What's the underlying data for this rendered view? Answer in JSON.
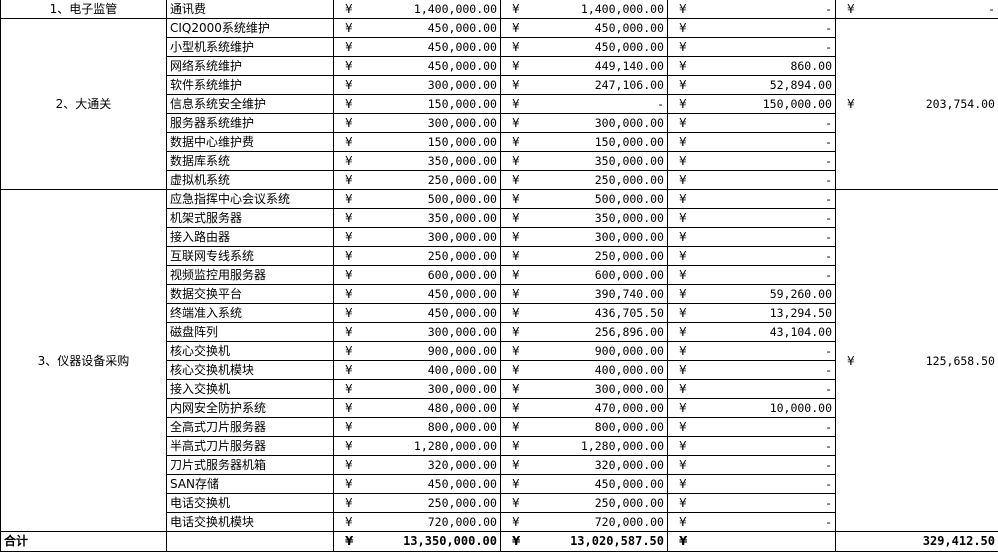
{
  "currency": "¥",
  "groups": [
    {
      "category": "1、电子监管",
      "subtotal": "-",
      "rows": [
        {
          "item": "通讯费",
          "budget": "1,400,000.00",
          "actual": "1,400,000.00",
          "diff": "-"
        }
      ]
    },
    {
      "category": "2、大通关",
      "subtotal": "203,754.00",
      "rows": [
        {
          "item": "CIQ2000系统维护",
          "budget": "450,000.00",
          "actual": "450,000.00",
          "diff": "-"
        },
        {
          "item": "小型机系统维护",
          "budget": "450,000.00",
          "actual": "450,000.00",
          "diff": "-"
        },
        {
          "item": "网络系统维护",
          "budget": "450,000.00",
          "actual": "449,140.00",
          "diff": "860.00"
        },
        {
          "item": "软件系统维护",
          "budget": "300,000.00",
          "actual": "247,106.00",
          "diff": "52,894.00"
        },
        {
          "item": "信息系统安全维护",
          "budget": "150,000.00",
          "actual": "-",
          "diff": "150,000.00"
        },
        {
          "item": "服务器系统维护",
          "budget": "300,000.00",
          "actual": "300,000.00",
          "diff": "-"
        },
        {
          "item": "数据中心维护费",
          "budget": "150,000.00",
          "actual": "150,000.00",
          "diff": "-"
        },
        {
          "item": "数据库系统",
          "budget": "350,000.00",
          "actual": "350,000.00",
          "diff": "-"
        },
        {
          "item": "虚拟机系统",
          "budget": "250,000.00",
          "actual": "250,000.00",
          "diff": "-"
        }
      ]
    },
    {
      "category": "3、仪器设备采购",
      "subtotal": "125,658.50",
      "rows": [
        {
          "item": "应急指挥中心会议系统",
          "budget": "500,000.00",
          "actual": "500,000.00",
          "diff": "-"
        },
        {
          "item": "机架式服务器",
          "budget": "350,000.00",
          "actual": "350,000.00",
          "diff": "-"
        },
        {
          "item": "接入路由器",
          "budget": "300,000.00",
          "actual": "300,000.00",
          "diff": "-"
        },
        {
          "item": "互联网专线系统",
          "budget": "250,000.00",
          "actual": "250,000.00",
          "diff": "-"
        },
        {
          "item": "视频监控用服务器",
          "budget": "600,000.00",
          "actual": "600,000.00",
          "diff": "-"
        },
        {
          "item": "数据交换平台",
          "budget": "450,000.00",
          "actual": "390,740.00",
          "diff": "59,260.00"
        },
        {
          "item": "终端准入系统",
          "budget": "450,000.00",
          "actual": "436,705.50",
          "diff": "13,294.50"
        },
        {
          "item": "磁盘阵列",
          "budget": "300,000.00",
          "actual": "256,896.00",
          "diff": "43,104.00"
        },
        {
          "item": "核心交换机",
          "budget": "900,000.00",
          "actual": "900,000.00",
          "diff": "-"
        },
        {
          "item": "核心交换机模块",
          "budget": "400,000.00",
          "actual": "400,000.00",
          "diff": "-"
        },
        {
          "item": "接入交换机",
          "budget": "300,000.00",
          "actual": "300,000.00",
          "diff": "-"
        },
        {
          "item": "内网安全防护系统",
          "budget": "480,000.00",
          "actual": "470,000.00",
          "diff": "10,000.00"
        },
        {
          "item": "全高式刀片服务器",
          "budget": "800,000.00",
          "actual": "800,000.00",
          "diff": "-"
        },
        {
          "item": "半高式刀片服务器",
          "budget": "1,280,000.00",
          "actual": "1,280,000.00",
          "diff": "-"
        },
        {
          "item": "刀片式服务器机箱",
          "budget": "320,000.00",
          "actual": "320,000.00",
          "diff": "-"
        },
        {
          "item": "SAN存储",
          "budget": "450,000.00",
          "actual": "450,000.00",
          "diff": "-"
        },
        {
          "item": "电话交换机",
          "budget": "250,000.00",
          "actual": "250,000.00",
          "diff": "-"
        },
        {
          "item": "电话交换机模块",
          "budget": "720,000.00",
          "actual": "720,000.00",
          "diff": "-"
        }
      ]
    }
  ],
  "total": {
    "label": "合计",
    "budget": "13,350,000.00",
    "actual": "13,020,587.50",
    "diff": "",
    "subtotal": "329,412.50"
  }
}
